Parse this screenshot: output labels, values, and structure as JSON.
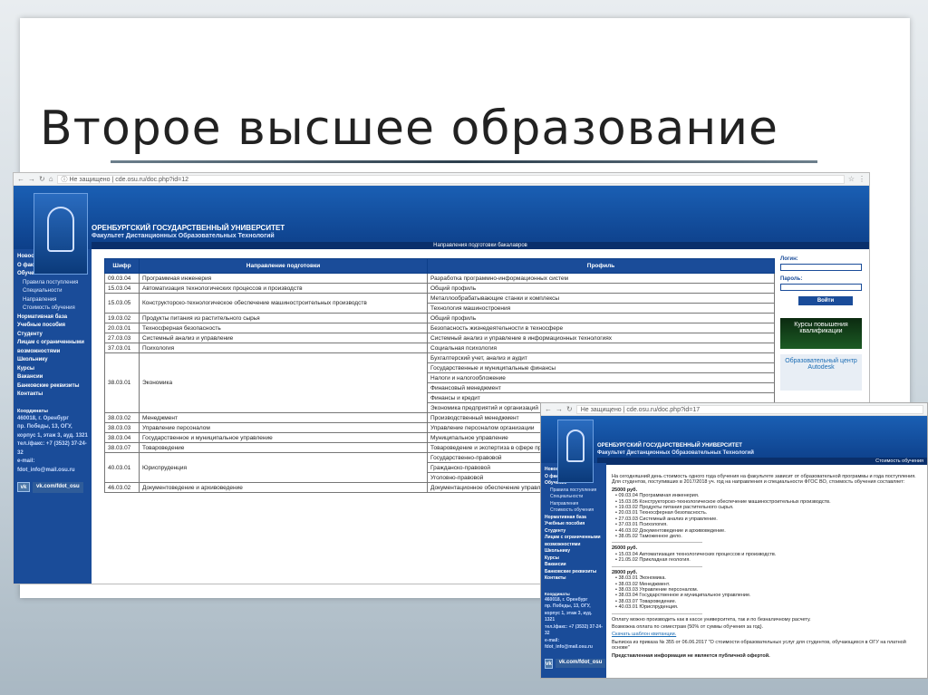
{
  "slide": {
    "title": "Второе высшее образование"
  },
  "shot1": {
    "browser": {
      "insecure_label": "Не защищено",
      "url": "cde.osu.ru/doc.php?id=12"
    },
    "header": {
      "university": "ОРЕНБУРГСКИЙ ГОСУДАРСТВЕННЫЙ УНИВЕРСИТЕТ",
      "faculty": "Факультет Дистанционных Образовательных Технологий",
      "section": "Направления подготовки бакалавров"
    },
    "nav": [
      {
        "label": "Новости",
        "sub": false
      },
      {
        "label": "О факультете",
        "sub": false
      },
      {
        "label": "Обучение",
        "sub": false
      },
      {
        "label": "Правила поступления",
        "sub": true
      },
      {
        "label": "Специальности",
        "sub": true
      },
      {
        "label": "Направления",
        "sub": true
      },
      {
        "label": "Стоимость обучения",
        "sub": true
      },
      {
        "label": "Нормативная база",
        "sub": false
      },
      {
        "label": "Учебные пособия",
        "sub": false
      },
      {
        "label": "Студенту",
        "sub": false
      },
      {
        "label": "Лицам с ограниченными возможностями",
        "sub": false
      },
      {
        "label": "Школьнику",
        "sub": false
      },
      {
        "label": "Курсы",
        "sub": false
      },
      {
        "label": "Вакансии",
        "sub": false
      },
      {
        "label": "Банковские реквизиты",
        "sub": false
      },
      {
        "label": "Контакты",
        "sub": false
      }
    ],
    "contacts": {
      "heading": "Координаты",
      "lines": [
        "460018, г. Оренбург",
        "пр. Победы, 13, ОГУ,",
        "корпус 1, этаж 3, ауд. 1321",
        "тел./факс: +7 (3532) 37-24-32",
        "e-mail: fdot_info@mail.osu.ru"
      ]
    },
    "vk": {
      "icon": "vk-icon",
      "label": "vk.com/fdot_osu"
    },
    "login": {
      "login_label": "Логин:",
      "password_label": "Пароль:",
      "button": "Войти"
    },
    "promo1": "Курсы повышения квалификации",
    "promo2": "Образовательный центр Autodesk",
    "table": {
      "headers": [
        "Шифр",
        "Направление подготовки",
        "Профиль"
      ],
      "rows": [
        {
          "code": "09.03.04",
          "direction": "Программная инженерия",
          "profiles": [
            "Разработка программно-информационных систем"
          ]
        },
        {
          "code": "15.03.04",
          "direction": "Автоматизация технологических процессов и производств",
          "profiles": [
            "Общий профиль"
          ]
        },
        {
          "code": "15.03.05",
          "direction": "Конструкторско-технологическое обеспечение машиностроительных производств",
          "profiles": [
            "Металлообрабатывающие станки и комплексы",
            "Технология машиностроения"
          ]
        },
        {
          "code": "19.03.02",
          "direction": "Продукты питания из растительного сырья",
          "profiles": [
            "Общий профиль"
          ]
        },
        {
          "code": "20.03.01",
          "direction": "Техносферная безопасность",
          "profiles": [
            "Безопасность жизнедеятельности в техносфере"
          ]
        },
        {
          "code": "27.03.03",
          "direction": "Системный анализ и управление",
          "profiles": [
            "Системный анализ и управление в информационных технологиях"
          ]
        },
        {
          "code": "37.03.01",
          "direction": "Психология",
          "profiles": [
            "Социальная психология"
          ]
        },
        {
          "code": "38.03.01",
          "direction": "Экономика",
          "profiles": [
            "Бухгалтерский учет, анализ и аудит",
            "Государственные и муниципальные финансы",
            "Налоги и налогообложение",
            "Финансовый менеджмент",
            "Финансы и кредит",
            "Экономика предприятий и организаций"
          ]
        },
        {
          "code": "38.03.02",
          "direction": "Менеджмент",
          "profiles": [
            "Производственный менеджмент"
          ]
        },
        {
          "code": "38.03.03",
          "direction": "Управление персоналом",
          "profiles": [
            "Управление персоналом организации"
          ]
        },
        {
          "code": "38.03.04",
          "direction": "Государственное и муниципальное управление",
          "profiles": [
            "Муниципальное управление"
          ]
        },
        {
          "code": "38.03.07",
          "direction": "Товароведение",
          "profiles": [
            "Товароведение и экспертиза в сфере производства"
          ]
        },
        {
          "code": "40.03.01",
          "direction": "Юриспруденция",
          "profiles": [
            "Государственно-правовой",
            "Гражданско-правовой",
            "Уголовно-правовой"
          ]
        },
        {
          "code": "46.03.02",
          "direction": "Документоведение и архивоведение",
          "profiles": [
            "Документационное обеспечение управления"
          ]
        }
      ]
    }
  },
  "shot2": {
    "browser": {
      "insecure_label": "Не защищено",
      "url": "cde.osu.ru/doc.php?id=17"
    },
    "header": {
      "university": "ОРЕНБУРГСКИЙ ГОСУДАРСТВЕННЫЙ УНИВЕРСИТЕТ",
      "faculty": "Факультет Дистанционных Образовательных Технологий",
      "section": "Стоимость обучения"
    },
    "intro": "На сегодняшний день стоимость одного года обучения на факультете зависит от образовательной программы и года поступления. Для студентов, поступивших в 2017/2018 уч. год на направления и специальности ФГОС ВО, стоимость обучения составляет:",
    "groups": [
      {
        "price": "25000 руб.",
        "items": [
          "09.03.04 Программная инженерия.",
          "15.03.05 Конструкторско-технологическое обеспечение машиностроительных производств.",
          "19.03.02 Продукты питания растительного сырья.",
          "20.03.01 Техносферная безопасность.",
          "27.03.03 Системный анализ и управление.",
          "37.03.01 Психология.",
          "46.03.02 Документоведение и архивоведение.",
          "38.05.02 Таможенное дело."
        ]
      },
      {
        "price": "26000 руб.",
        "items": [
          "15.03.04 Автоматизация технологических процессов и производств.",
          "21.05.02 Прикладная геология."
        ]
      },
      {
        "price": "28000 руб.",
        "items": [
          "38.03.01 Экономика.",
          "38.03.02 Менеджмент.",
          "38.03.03 Управление персоналом.",
          "38.03.04 Государственное и муниципальное управление.",
          "38.03.07 Товароведение.",
          "40.03.01 Юриспруденция."
        ]
      }
    ],
    "footer": [
      "Оплату можно производить как в кассе университета, так и по безналичному расчету.",
      "Возможна оплата по семестрам (50% от суммы обучения за год).",
      "Скачать шаблон квитанции.",
      "Выписка из приказа № 355 от 06.06.2017 \"О стоимости образовательных услуг для студентов, обучающихся в ОГУ на платной основе\"",
      "Представленная информация не является публичной офертой."
    ]
  }
}
